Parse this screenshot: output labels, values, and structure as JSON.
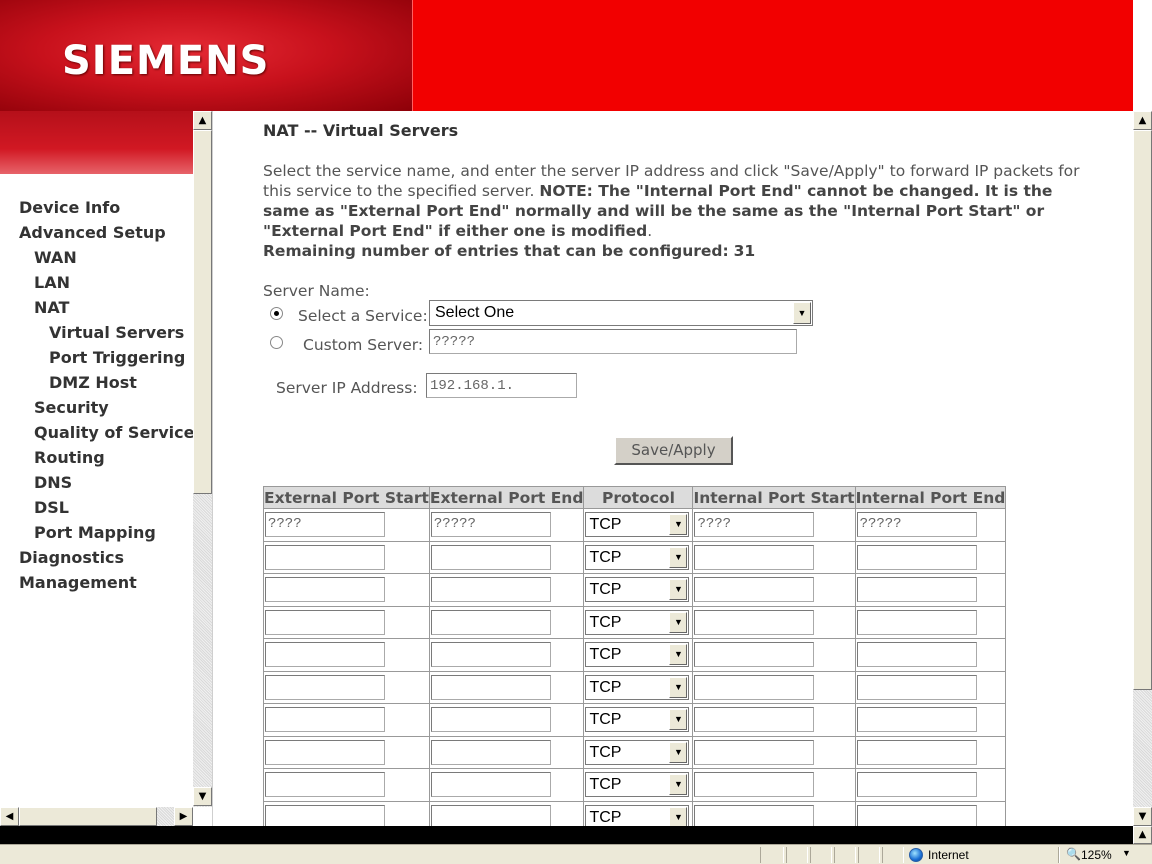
{
  "header": {
    "logo": "SIEMENS"
  },
  "nav": [
    {
      "label": "Device Info",
      "level": 0
    },
    {
      "label": "Advanced Setup",
      "level": 0
    },
    {
      "label": "WAN",
      "level": 1
    },
    {
      "label": "LAN",
      "level": 1
    },
    {
      "label": "NAT",
      "level": 1
    },
    {
      "label": "Virtual Servers",
      "level": 2
    },
    {
      "label": "Port Triggering",
      "level": 2
    },
    {
      "label": "DMZ Host",
      "level": 2
    },
    {
      "label": "Security",
      "level": 1
    },
    {
      "label": "Quality of Service",
      "level": 1
    },
    {
      "label": "Routing",
      "level": 1
    },
    {
      "label": "DNS",
      "level": 1
    },
    {
      "label": "DSL",
      "level": 1
    },
    {
      "label": "Port Mapping",
      "level": 1
    },
    {
      "label": "Diagnostics",
      "level": 0
    },
    {
      "label": "Management",
      "level": 0
    }
  ],
  "page": {
    "title": "NAT -- Virtual Servers",
    "desc_plain": "Select the service name, and enter the server IP address and click \"Save/Apply\" to forward IP packets for this service to the specified server.",
    "desc_note": "NOTE: The \"Internal Port End\" cannot be changed. It is the same as \"External Port End\" normally and will be the same as the \"Internal Port Start\" or \"External Port End\" if either one is modified",
    "desc_period": ".",
    "remaining_label": "Remaining number of entries that can be configured:",
    "remaining_count": "31"
  },
  "form": {
    "server_name_label": "Server Name:",
    "select_service_label": "Select a Service:",
    "select_service_value": "Select One",
    "custom_server_label": "Custom Server:",
    "custom_server_value": "?????",
    "server_ip_label": "Server IP Address:",
    "server_ip_value": "192.168.1.",
    "save_label": "Save/Apply"
  },
  "table": {
    "headers": [
      "External Port Start",
      "External Port End",
      "Protocol",
      "Internal Port Start",
      "Internal Port End"
    ],
    "rows": [
      {
        "ext_start": "????",
        "ext_end": "?????",
        "protocol": "TCP",
        "int_start": "????",
        "int_end": "?????"
      },
      {
        "ext_start": "",
        "ext_end": "",
        "protocol": "TCP",
        "int_start": "",
        "int_end": ""
      },
      {
        "ext_start": "",
        "ext_end": "",
        "protocol": "TCP",
        "int_start": "",
        "int_end": ""
      },
      {
        "ext_start": "",
        "ext_end": "",
        "protocol": "TCP",
        "int_start": "",
        "int_end": ""
      },
      {
        "ext_start": "",
        "ext_end": "",
        "protocol": "TCP",
        "int_start": "",
        "int_end": ""
      },
      {
        "ext_start": "",
        "ext_end": "",
        "protocol": "TCP",
        "int_start": "",
        "int_end": ""
      },
      {
        "ext_start": "",
        "ext_end": "",
        "protocol": "TCP",
        "int_start": "",
        "int_end": ""
      },
      {
        "ext_start": "",
        "ext_end": "",
        "protocol": "TCP",
        "int_start": "",
        "int_end": ""
      },
      {
        "ext_start": "",
        "ext_end": "",
        "protocol": "TCP",
        "int_start": "",
        "int_end": ""
      },
      {
        "ext_start": "",
        "ext_end": "",
        "protocol": "TCP",
        "int_start": "",
        "int_end": ""
      }
    ]
  },
  "status": {
    "zone": "Internet",
    "zoom": "125%"
  },
  "colors": {
    "brand_red": "#f20000",
    "text": "#555555",
    "nav_text": "#333333"
  }
}
